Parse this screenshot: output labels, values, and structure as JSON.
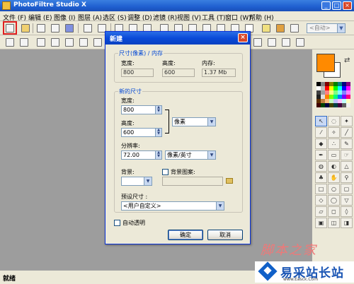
{
  "app": {
    "title": "PhotoFiltre Studio X"
  },
  "menu": [
    "文件 (F)",
    "编辑 (E)",
    "图像 (I)",
    "图层 (A)",
    "选区 (S)",
    "调整 (D)",
    "滤镜 (R)",
    "视图 (V)",
    "工具 (T)",
    "窗口 (W)",
    "帮助 (H)"
  ],
  "toolbar": {
    "zoom_value": "<自动>"
  },
  "status": {
    "text": "就绪"
  },
  "dialog": {
    "title": "新建",
    "size_pixels_group": "尺寸(像素) / 内存",
    "width_label": "宽度:",
    "height_label": "高度:",
    "memory_label": "内存:",
    "width_ro": "800",
    "height_ro": "600",
    "memory_ro": "1.37 Mb",
    "new_size_group": "新的尺寸",
    "new_width_label": "宽度:",
    "new_width": "800",
    "new_height_label": "高度:",
    "new_height": "600",
    "unit": "像素",
    "resolution_label": "分辨率:",
    "resolution": "72.00",
    "resolution_unit": "像素/英寸",
    "background_label": "背景:",
    "background_pattern_label": "背景图案:",
    "preset_label": "预设尺寸 :",
    "preset_value": "<用户自定义>",
    "auto_transparent_label": "自动透明",
    "ok_label": "确定",
    "cancel_label": "取消"
  },
  "colors": {
    "foreground": "#ff8a00",
    "background": "#ffffff",
    "accent": "#0a4ad8"
  },
  "watermark": {
    "line1": "脚本之家",
    "brand": "易采站长站",
    "url": "www.Easck.Com"
  }
}
